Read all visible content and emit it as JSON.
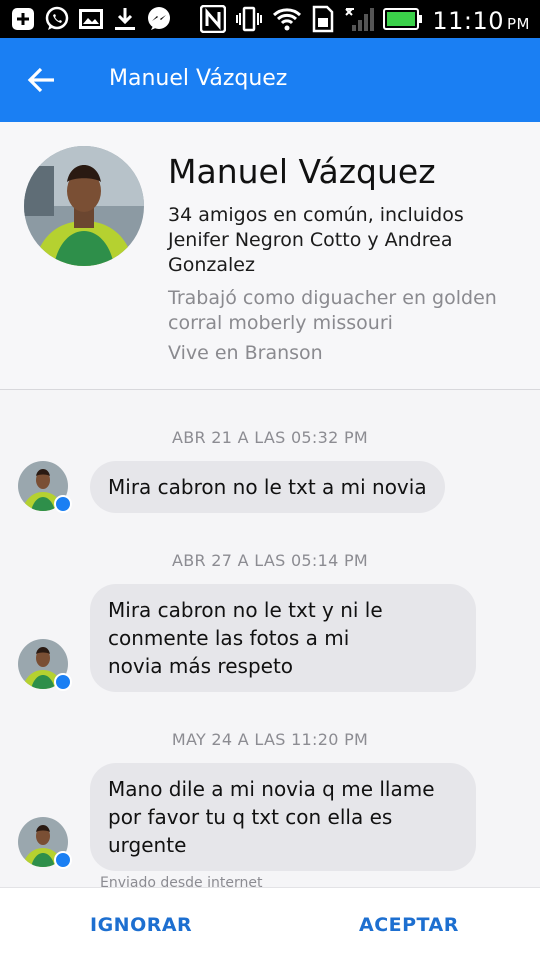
{
  "status_bar": {
    "time": "11:10",
    "ampm": "PM",
    "icons": [
      "add-icon",
      "whatsapp-icon",
      "image-icon",
      "download-icon",
      "messenger-icon",
      "nfc-icon",
      "vibrate-icon",
      "wifi-icon",
      "sim-icon",
      "signal-icon",
      "battery-icon"
    ]
  },
  "app_bar": {
    "title": "Manuel Vázquez",
    "color": "#1a7ff3"
  },
  "profile": {
    "name": "Manuel Vázquez",
    "mutual_friends_line1": "34 amigos en común, incluidos",
    "mutual_friends_line2": "Jenifer Negron Cotto y Andrea",
    "mutual_friends_line3": "Gonzalez",
    "work_line1": "Trabajó como diguacher en golden",
    "work_line2": "corral moberly missouri",
    "lives": "Vive en Branson"
  },
  "messages": [
    {
      "timestamp": "ABR 21 A LAS 05:32 PM",
      "lines": [
        "Mira cabron no le txt a mi novia"
      ]
    },
    {
      "timestamp": "ABR 27 A LAS 05:14 PM",
      "lines": [
        "Mira cabron no le txt y ni le",
        "conmente las fotos a mi",
        "novia más respeto"
      ]
    },
    {
      "timestamp": "MAY 24 A LAS 11:20 PM",
      "lines": [
        "Mano dile a mi novia q me llame",
        "por favor tu q txt con ella es",
        "urgente"
      ]
    }
  ],
  "sent_from": "Enviado desde internet",
  "actions": {
    "ignore": "IGNORAR",
    "accept": "ACEPTAR"
  }
}
